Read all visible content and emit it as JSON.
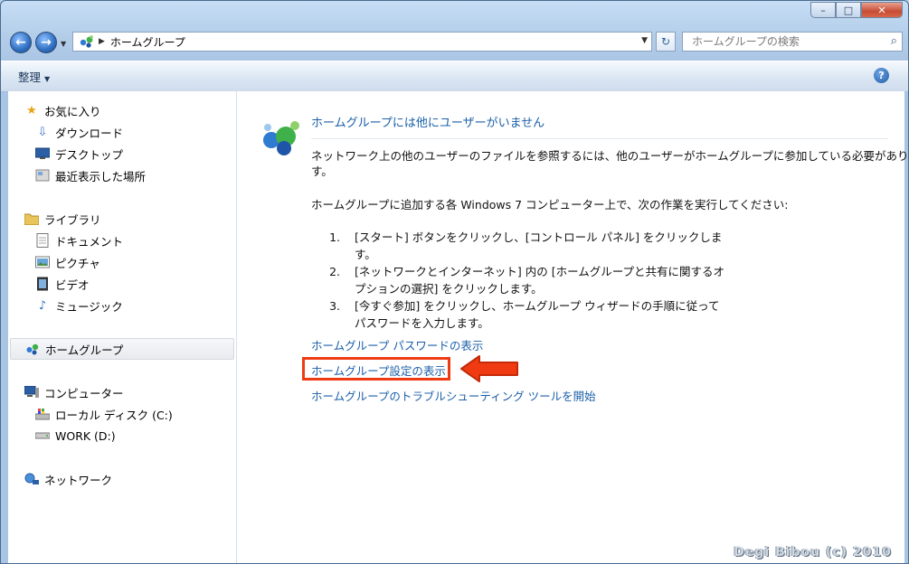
{
  "window": {
    "min_label": "–",
    "max_label": "□",
    "close_label": "✕"
  },
  "address_bar": {
    "crumb": "ホームグループ",
    "search_placeholder": "ホームグループの検索"
  },
  "command_bar": {
    "organize_label": "整理",
    "help_label": "?"
  },
  "sidebar": {
    "favorites": [
      {
        "label": "お気に入り",
        "icon": "star-icon"
      },
      {
        "label": "ダウンロード",
        "icon": "download-icon"
      },
      {
        "label": "デスクトップ",
        "icon": "desktop-icon"
      },
      {
        "label": "最近表示した場所",
        "icon": "recent-places-icon"
      }
    ],
    "libraries": [
      {
        "label": "ライブラリ",
        "icon": "library-icon"
      },
      {
        "label": "ドキュメント",
        "icon": "document-icon"
      },
      {
        "label": "ピクチャ",
        "icon": "picture-icon"
      },
      {
        "label": "ビデオ",
        "icon": "video-icon"
      },
      {
        "label": "ミュージック",
        "icon": "music-icon"
      }
    ],
    "homegroup": {
      "label": "ホームグループ",
      "icon": "homegroup-icon"
    },
    "computer": [
      {
        "label": "コンピューター",
        "icon": "computer-icon"
      },
      {
        "label": "ローカル ディスク (C:)",
        "icon": "local-disk-icon"
      },
      {
        "label": "WORK (D:)",
        "icon": "drive-icon"
      }
    ],
    "network": {
      "label": "ネットワーク",
      "icon": "network-icon"
    }
  },
  "main": {
    "heading": "ホームグループには他にユーザーがいません",
    "intro_line1": "ネットワーク上の他のユーザーのファイルを参照するには、他のユーザーがホームグループに参加している必要がありま",
    "intro_line2": "す。",
    "instruction": "ホームグループに追加する各 Windows 7 コンピューター上で、次の作業を実行してください:",
    "steps": [
      {
        "num": "1.",
        "text": "[スタート] ボタンをクリックし、[コントロール パネル] をクリックします。"
      },
      {
        "num": "2.",
        "text": "[ネットワークとインターネット] 内の [ホームグループと共有に関するオプションの選択] をクリックします。"
      },
      {
        "num": "3.",
        "text": "[今すぐ参加] をクリックし、ホームグループ ウィザードの手順に従ってパスワードを入力します。"
      }
    ],
    "links": {
      "show_password": "ホームグループ パスワードの表示",
      "show_settings": "ホームグループ設定の表示",
      "troubleshoot": "ホームグループのトラブルシューティング ツールを開始"
    }
  },
  "watermark": "Degi Bibou (c) 2010",
  "colors": {
    "link": "#1b5fa8",
    "highlight": "#f03b12"
  }
}
